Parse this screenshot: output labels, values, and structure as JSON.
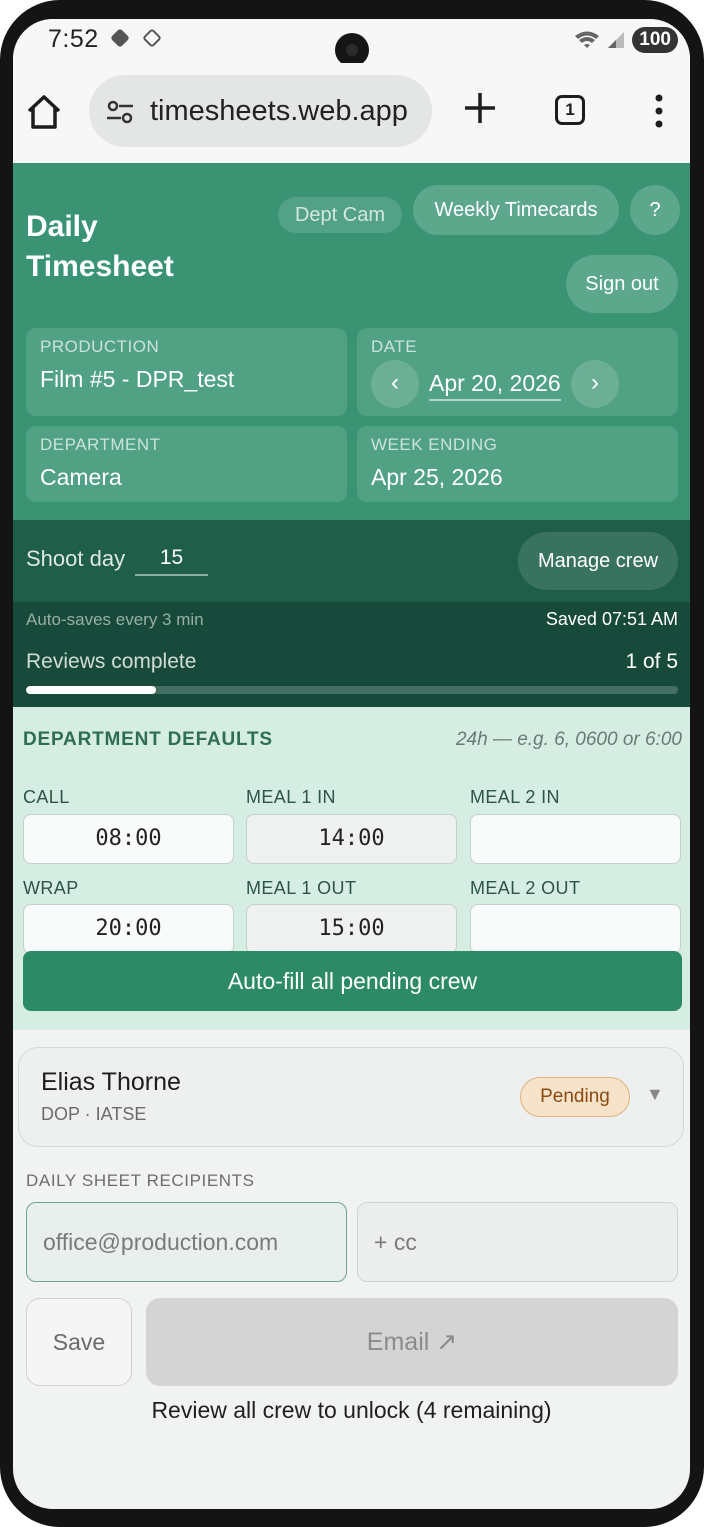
{
  "status": {
    "time": "7:52",
    "battery": "100"
  },
  "browser": {
    "url": "timesheets.web.app",
    "tab_count": "1"
  },
  "header": {
    "title": "Daily Timesheet",
    "dept_pill": "Dept Cam",
    "weekly_button": "Weekly Timecards",
    "help_button": "?",
    "signout_button": "Sign out",
    "production_label": "PRODUCTION",
    "production_value": "Film #5 - DPR_test",
    "date_label": "DATE",
    "date_value": "Apr 20, 2026",
    "prev_glyph": "‹",
    "next_glyph": "›",
    "department_label": "DEPARTMENT",
    "department_value": "Camera",
    "week_ending_label": "WEEK ENDING",
    "week_ending_value": "Apr 25, 2026"
  },
  "day": {
    "shoot_day_label": "Shoot day",
    "shoot_day_value": "15",
    "manage_crew": "Manage crew",
    "autosave_text": "Auto-saves every 3 min",
    "saved_text": "Saved 07:51 AM",
    "reviews_label": "Reviews complete",
    "reviews_count": "1 of 5",
    "reviews_progress": 0.2
  },
  "defaults": {
    "title": "DEPARTMENT DEFAULTS",
    "hint": "24h — e.g. 6, 0600 or 6:00",
    "call_label": "CALL",
    "call_value": "08:00",
    "meal1in_label": "MEAL 1 IN",
    "meal1in_value": "14:00",
    "meal2in_label": "MEAL 2 IN",
    "meal2in_value": "",
    "wrap_label": "WRAP",
    "wrap_value": "20:00",
    "meal1out_label": "MEAL 1 OUT",
    "meal1out_value": "15:00",
    "meal2out_label": "MEAL 2 OUT",
    "meal2out_value": "",
    "autofill_button": "Auto-fill all pending crew"
  },
  "crew": {
    "name": "Elias Thorne",
    "role": "DOP · IATSE",
    "status": "Pending",
    "expand_glyph": "▼"
  },
  "recipients": {
    "title": "DAILY SHEET RECIPIENTS",
    "to_placeholder": "office@production.com",
    "cc_placeholder": "+ cc",
    "save_button": "Save",
    "email_button": "Email ↗",
    "unlock_text": "Review all crew to unlock (4 remaining)"
  },
  "colors": {
    "header_green": "#3a9474",
    "band_dark": "#1f5f4a",
    "defaults_bg": "#d6ede3",
    "accent_button": "#2c8a67",
    "pending_badge": "#f7e3c9"
  }
}
